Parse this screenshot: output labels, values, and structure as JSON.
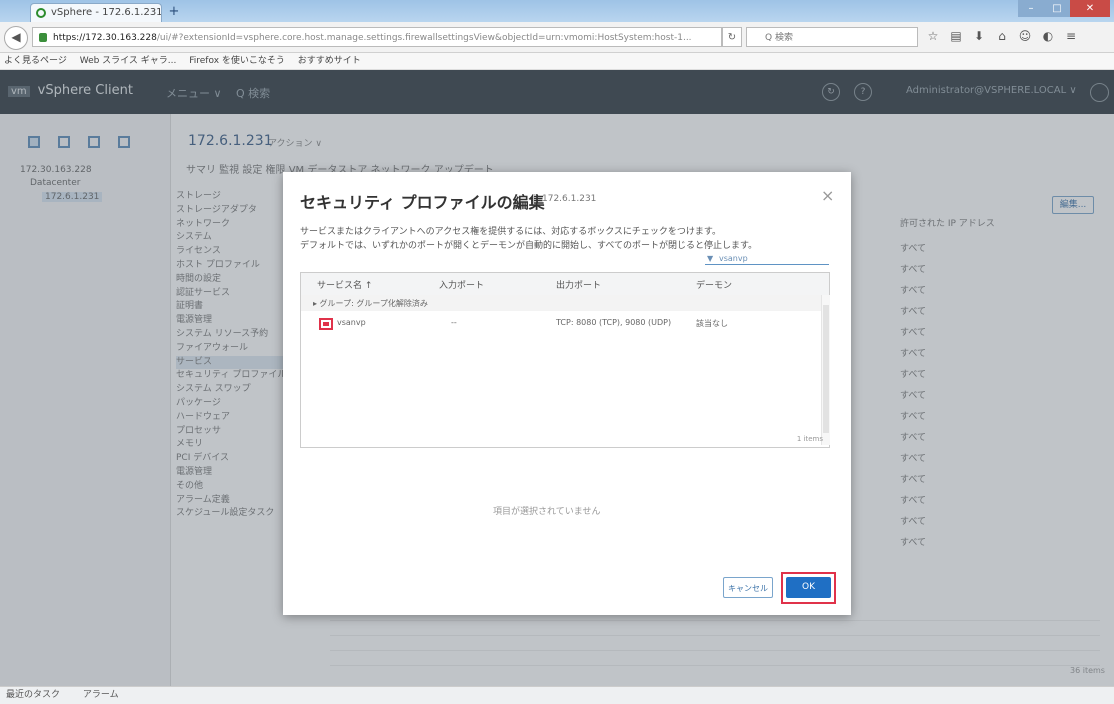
{
  "browser": {
    "tab_title": "vSphere - 172.6.1.231 - …  ×",
    "url_host": "https://172.30.163.228",
    "url_rest": "/ui/#?extensionId=vsphere.core.host.manage.settings.firewallsettingsView&objectId=urn:vmomi:HostSystem:host-1...",
    "search_text": "Q 検索",
    "bookmarks": [
      "よく見るページ",
      "Web スライス ギャラ...",
      "Firefox を使いこなそう",
      "おすすめサイト"
    ]
  },
  "app": {
    "logo_badge": "vm",
    "title": "vSphere Client",
    "menu": "メニュー ∨",
    "search": "Q 検索",
    "user": "Administrator@VSPHERE.LOCAL ∨"
  },
  "tree": {
    "items": [
      "172.30.163.228",
      "Datacenter",
      "172.6.1.231"
    ]
  },
  "host": {
    "title": "172.6.1.231",
    "actions": "アクション ∨",
    "tabs": "サマリ   監視   設定   権限   VM   データストア   ネットワーク   アップデート"
  },
  "settings_nav": [
    "ストレージ",
    "ストレージアダプタ",
    "ネットワーク",
    "システム",
    "ライセンス",
    "ホスト プロファイル",
    "時間の設定",
    "認証サービス",
    "証明書",
    "電源管理",
    "システム リソース予約",
    "ファイアウォール",
    "サービス",
    "セキュリティ プロファイル",
    "システム スワップ",
    "パッケージ",
    "ハードウェア",
    "プロセッサ",
    "メモリ",
    "PCI デバイス",
    "電源管理",
    "その他",
    "アラーム定義",
    "スケジュール設定タスク"
  ],
  "bg_right": {
    "button": "編集...",
    "col_header": "許可された IP アドレス",
    "col_values": [
      "すべて",
      "すべて",
      "すべて",
      "すべて",
      "すべて",
      "すべて",
      "すべて",
      "すべて",
      "すべて",
      "すべて",
      "すべて",
      "すべて",
      "すべて",
      "すべて",
      "すべて"
    ],
    "footer": "36 items"
  },
  "status_bar": [
    "最近のタスク",
    "アラーム"
  ],
  "dialog": {
    "title": "セキュリティ プロファイルの編集",
    "host": "172.6.1.231",
    "close": "×",
    "desc1": "サービスまたはクライアントへのアクセス権を提供するには、対応するボックスにチェックをつけます。",
    "desc2": "デフォルトでは、いずれかのポートが開くとデーモンが自動的に開始し、すべてのポートが閉じると停止します。",
    "filter_icon": "▼",
    "filter_value": "vsanvp",
    "columns": [
      "サービス名 ↑",
      "入力ポート",
      "出力ポート",
      "デーモン"
    ],
    "group_label": "▸ グループ: グループ化解除済み",
    "rows": [
      {
        "name": "vsanvp",
        "in": "--",
        "out": "TCP: 8080 (TCP), 9080 (UDP)",
        "daemon": "該当なし"
      }
    ],
    "grid_footer": "1 items",
    "empty_text": "項目が選択されていません",
    "cancel_label": "キャンセル",
    "ok_label": "OK"
  }
}
